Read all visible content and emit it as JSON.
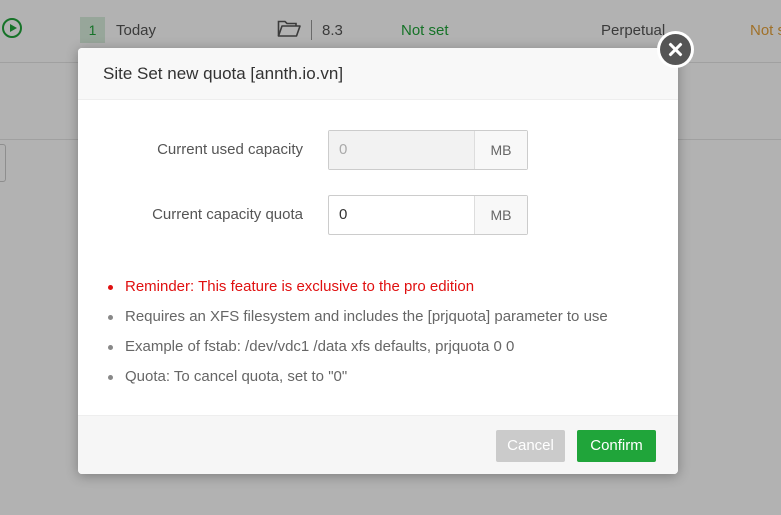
{
  "background": {
    "row_number": "1",
    "row_date": "Today",
    "row_version": "8.3",
    "row_status": "Not set",
    "row_expiry": "Perpetual",
    "row_status2": "Not set"
  },
  "dialog": {
    "title": "Site Set new quota [annth.io.vn]",
    "fields": [
      {
        "label": "Current used capacity",
        "value": "0",
        "unit": "MB"
      },
      {
        "label": "Current capacity quota",
        "value": "0",
        "unit": "MB"
      }
    ],
    "notes": [
      "Reminder: This feature is exclusive to the pro edition",
      "Requires an XFS filesystem and includes the [prjquota] parameter to use",
      "Example of fstab: /dev/vdc1 /data xfs defaults, prjquota 0 0",
      "Quota: To cancel quota, set to \"0\""
    ],
    "cancel_label": "Cancel",
    "confirm_label": "Confirm"
  },
  "colors": {
    "accent": "#20a53a",
    "warning_text": "#e01010",
    "expiry_status": "#e6a23c"
  },
  "icons": [
    "play-circle-icon",
    "folder-open-icon",
    "close-icon"
  ]
}
